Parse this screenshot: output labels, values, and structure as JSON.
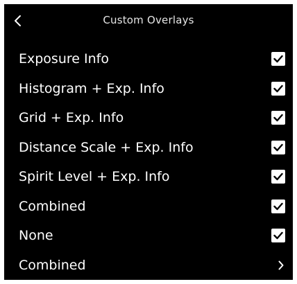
{
  "header": {
    "title": "Custom Overlays",
    "back_icon": "chevron-left-icon"
  },
  "overlay_options": [
    {
      "label": "Exposure Info",
      "checked": true
    },
    {
      "label": "Histogram + Exp. Info",
      "checked": true
    },
    {
      "label": "Grid + Exp. Info",
      "checked": true
    },
    {
      "label": "Distance Scale + Exp. Info",
      "checked": true
    },
    {
      "label": "Spirit Level + Exp. Info",
      "checked": true
    },
    {
      "label": "Combined",
      "checked": true
    },
    {
      "label": "None",
      "checked": true
    }
  ],
  "combined_link": {
    "label": "Combined",
    "icon": "chevron-right-icon"
  },
  "colors": {
    "background": "#000000",
    "text": "#ffffff",
    "checkbox_fill": "#ffffff",
    "checkmark": "#000000"
  }
}
